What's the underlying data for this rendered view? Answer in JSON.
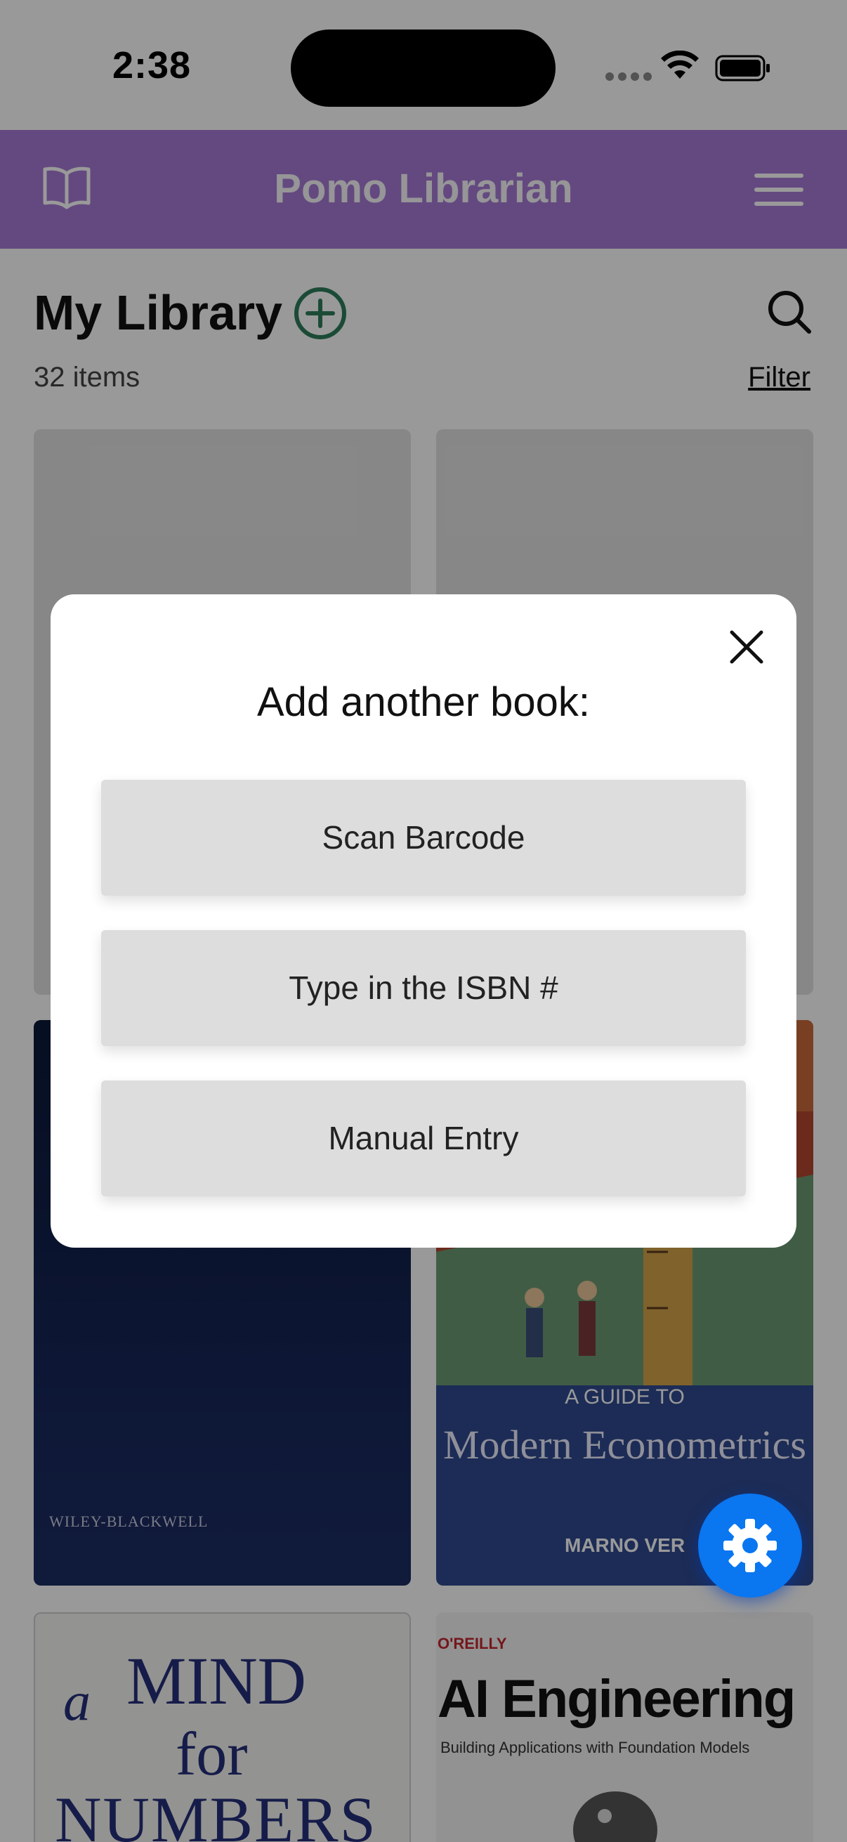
{
  "status_bar": {
    "time": "2:38"
  },
  "header": {
    "title": "Pomo Librarian",
    "book_icon": "open-book-icon",
    "menu_icon": "hamburger-menu-icon"
  },
  "library": {
    "title": "My Library",
    "count_label": "32 items",
    "filter_label": "Filter",
    "add_icon": "plus-circle-icon",
    "search_icon": "search-icon"
  },
  "books": [
    {
      "cover": "placeholder"
    },
    {
      "cover": "placeholder"
    },
    {
      "publisher": "WILEY-BLACKWELL"
    },
    {
      "tagline": "A GUIDE TO",
      "title": "Modern Econometrics",
      "author": "MARNO VER"
    },
    {
      "title_a": "a",
      "title_main": "MIND",
      "title_for": "for",
      "title_numbers": "NUMBERS"
    },
    {
      "publisher": "O'REILLY",
      "title": "AI Engineering",
      "subtitle": "Building Applications with Foundation Models"
    }
  ],
  "fab": {
    "icon": "gear-icon"
  },
  "modal": {
    "title": "Add another book:",
    "close_icon": "close-icon",
    "options": [
      "Scan Barcode",
      "Type in the ISBN #",
      "Manual Entry"
    ]
  },
  "colors": {
    "header_bg": "#a77ad5",
    "accent_green": "#2e7d5b",
    "fab_blue": "#0a76f0",
    "overlay": "rgba(0,0,0,0.40)"
  }
}
